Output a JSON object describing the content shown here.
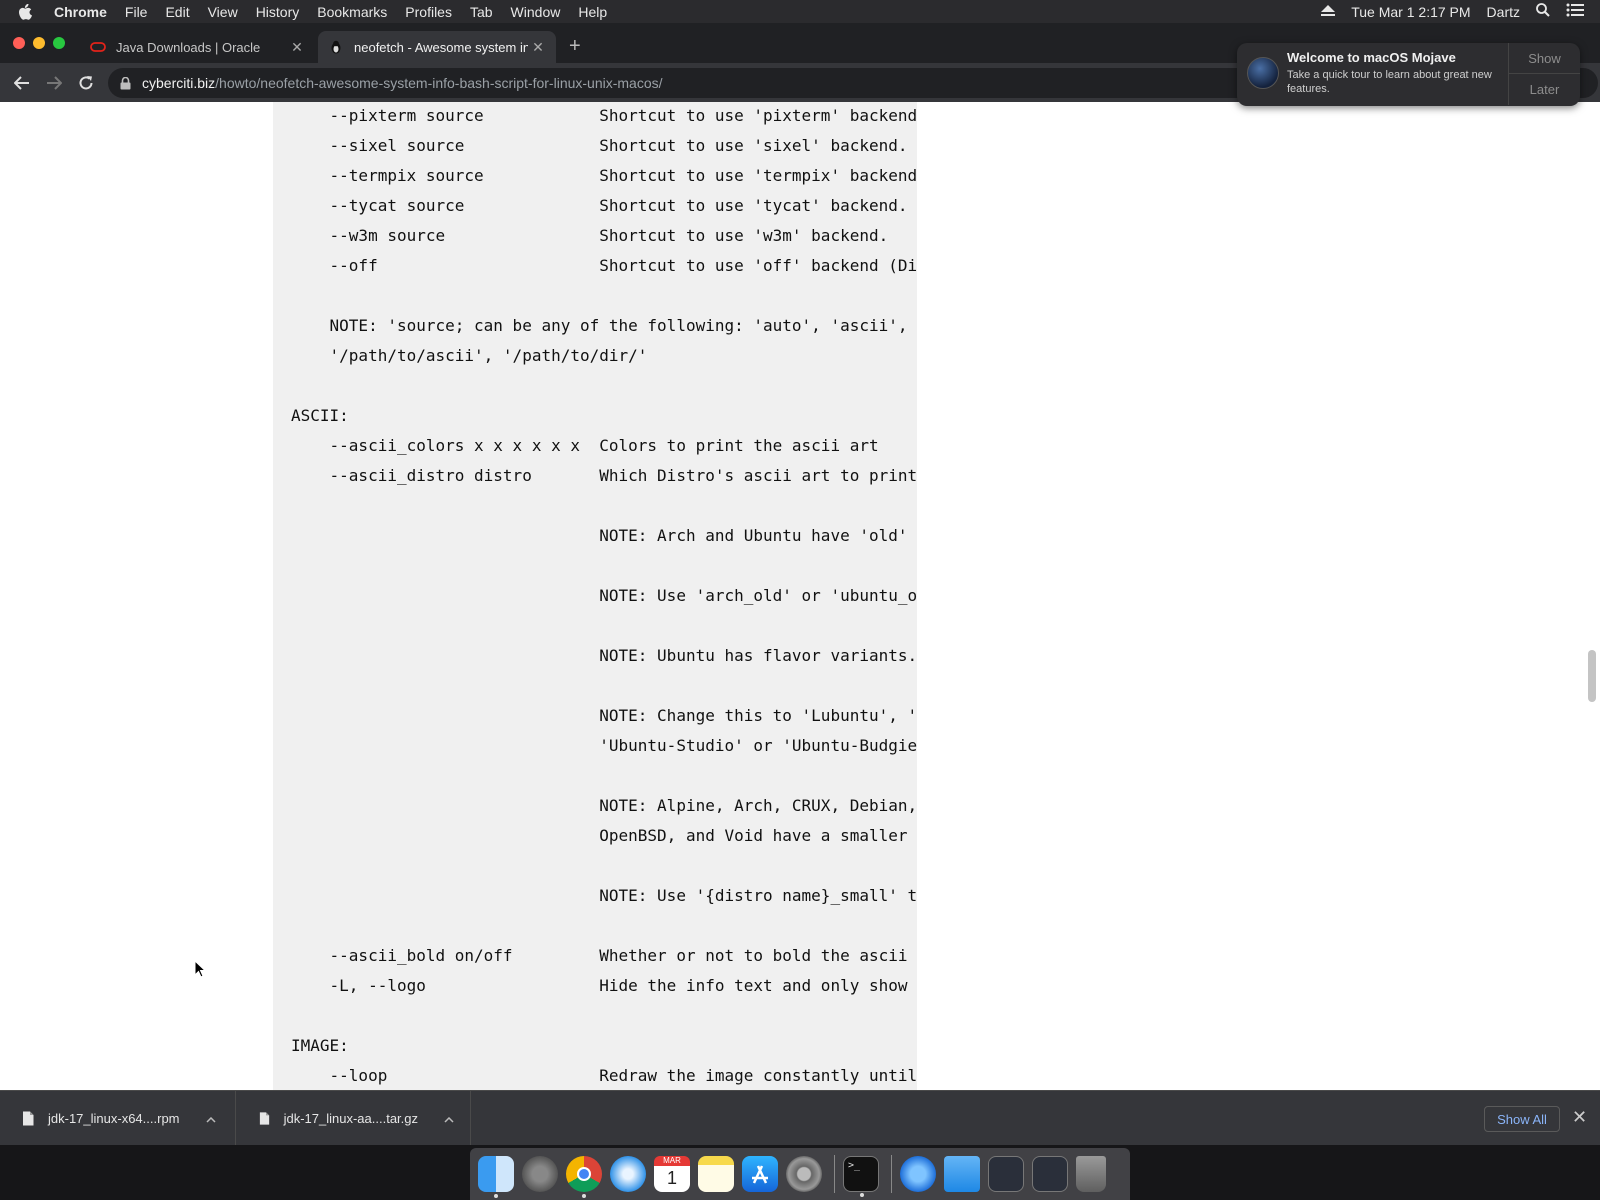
{
  "menubar": {
    "app": "Chrome",
    "items": [
      "File",
      "Edit",
      "View",
      "History",
      "Bookmarks",
      "Profiles",
      "Tab",
      "Window",
      "Help"
    ],
    "datetime": "Tue Mar 1  2:17 PM",
    "user": "Dartz"
  },
  "tabs": [
    {
      "title": "Java Downloads | Oracle",
      "close": "✕"
    },
    {
      "title": "neofetch - Awesome system in",
      "close": "✕"
    }
  ],
  "newtab": "+",
  "address": {
    "domain": "cyberciti.biz",
    "path": "/howto/neofetch-awesome-system-info-bash-script-for-linux-unix-macos/"
  },
  "code_lines": [
    "    --pixterm source            Shortcut to use 'pixterm' backend",
    "    --sixel source              Shortcut to use 'sixel' backend.",
    "    --termpix source            Shortcut to use 'termpix' backend",
    "    --tycat source              Shortcut to use 'tycat' backend.",
    "    --w3m source                Shortcut to use 'w3m' backend.",
    "    --off                       Shortcut to use 'off' backend (Di",
    "",
    "    NOTE: 'source; can be any of the following: 'auto', 'ascii',",
    "    '/path/to/ascii', '/path/to/dir/'",
    "",
    "ASCII:",
    "    --ascii_colors x x x x x x  Colors to print the ascii art",
    "    --ascii_distro distro       Which Distro's ascii art to print",
    "",
    "                                NOTE: Arch and Ubuntu have 'old'",
    "",
    "                                NOTE: Use 'arch_old' or 'ubuntu_o",
    "",
    "                                NOTE: Ubuntu has flavor variants.",
    "",
    "                                NOTE: Change this to 'Lubuntu', '",
    "                                'Ubuntu-Studio' or 'Ubuntu-Budgie",
    "",
    "                                NOTE: Alpine, Arch, CRUX, Debian,",
    "                                OpenBSD, and Void have a smaller",
    "",
    "                                NOTE: Use '{distro name}_small' t",
    "",
    "    --ascii_bold on/off         Whether or not to bold the ascii",
    "    -L, --logo                  Hide the info text and only show",
    "",
    "IMAGE:",
    "    --loop                      Redraw the image constantly until"
  ],
  "notification": {
    "title": "Welcome to macOS Mojave",
    "body": "Take a quick tour to learn about great new features.",
    "show": "Show",
    "later": "Later"
  },
  "downloads": [
    {
      "name": "jdk-17_linux-x64....rpm"
    },
    {
      "name": "jdk-17_linux-aa....tar.gz"
    }
  ],
  "show_all": "Show All",
  "shelf_close": "✕",
  "dock_icons": [
    "finder-icon",
    "launchpad-icon",
    "chrome-icon",
    "safari-icon",
    "calendar-icon",
    "notes-icon",
    "app-store-icon",
    "system-preferences-icon",
    "terminal-icon",
    "xcode-icon",
    "folder-icon",
    "screenshot-icon",
    "screenshot2-icon",
    "trash-icon"
  ],
  "calendar": {
    "month": "MAR",
    "day": "1"
  },
  "colors": {
    "accent_link": "#8ab4f8",
    "code_bg": "#f0f0f0"
  }
}
